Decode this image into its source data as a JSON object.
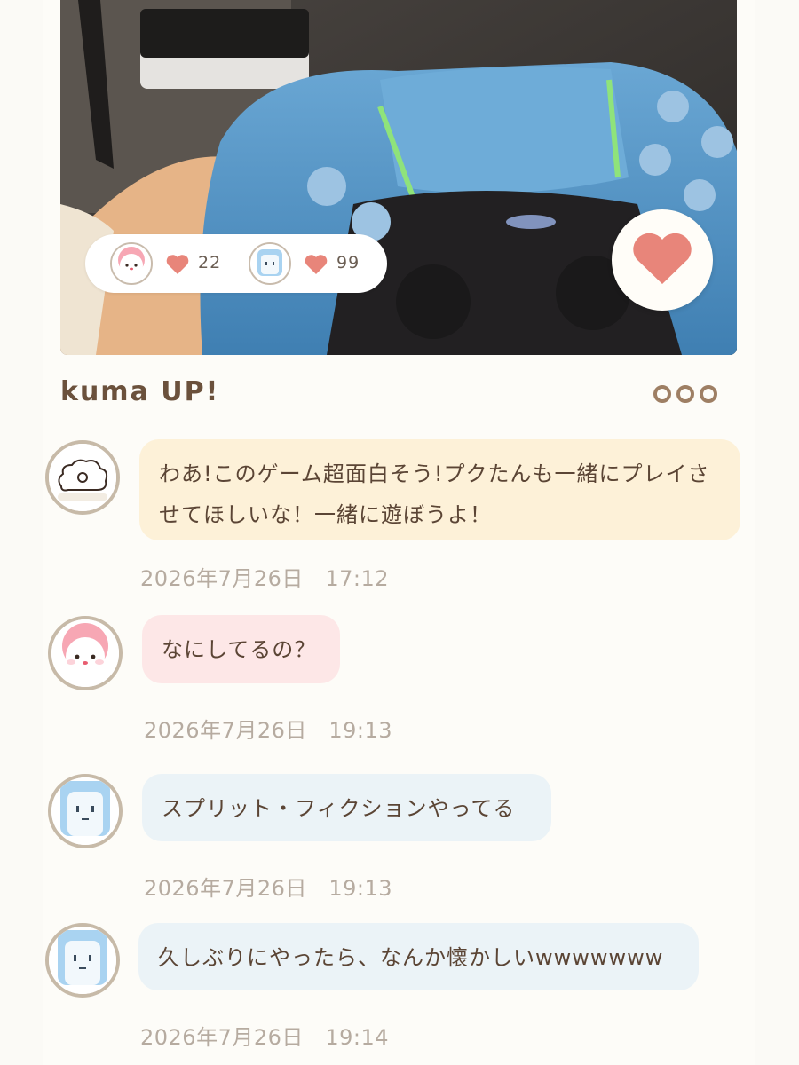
{
  "post": {
    "title": "kuma UP!",
    "photo_label": "game-controller-photo"
  },
  "likes": [
    {
      "avatar": "pink-bear-avatar",
      "count": "22"
    },
    {
      "avatar": "blue-block-avatar",
      "count": "99"
    }
  ],
  "colors": {
    "heart": "#e8857a",
    "yellow_bubble": "#fdf1d8",
    "pink_bubble": "#fde7e7",
    "blue_bubble": "#ebf3f7"
  },
  "comments": [
    {
      "avatar": "white-cloud-avatar",
      "text": "わあ!このゲーム超面白そう!プクたんも一緒にプレイさせてほしいな！一緒に遊ぼうよ！",
      "time": "2026年7月26日　17:12"
    },
    {
      "avatar": "pink-bear-avatar",
      "text": "なにしてるの？",
      "time": "2026年7月26日　19:13"
    },
    {
      "avatar": "blue-block-avatar",
      "text": "スプリット・フィクションやってる",
      "time": "2026年7月26日　19:13"
    },
    {
      "avatar": "blue-block-avatar",
      "text": "久しぶりにやったら、なんか懐かしいwwwwwww",
      "time": "2026年7月26日　19:14"
    }
  ]
}
